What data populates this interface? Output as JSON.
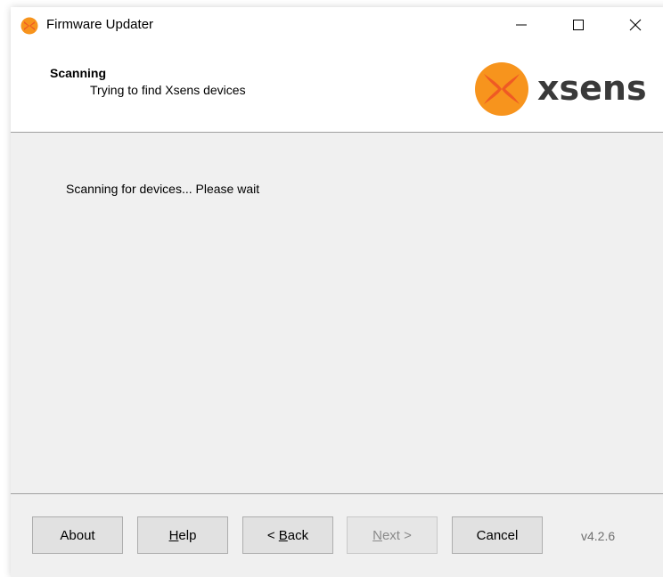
{
  "window": {
    "title": "Firmware Updater",
    "icon": "xsens-app-icon"
  },
  "header": {
    "title": "Scanning",
    "subtitle": "Trying to find Xsens devices",
    "logo_text": "xsens",
    "logo_color": "#3a3a3a",
    "brand_colors": [
      "#f7941d",
      "#ef5a24"
    ]
  },
  "content": {
    "status": "Scanning for devices... Please wait"
  },
  "footer": {
    "about_label": "About",
    "help_prefix": "",
    "help_underline": "H",
    "help_rest": "elp",
    "back_prefix": "< ",
    "back_underline": "B",
    "back_rest": "ack",
    "next_prefix": "",
    "next_underline": "N",
    "next_rest": "ext >",
    "cancel_label": "Cancel",
    "version": "v4.2.6"
  }
}
